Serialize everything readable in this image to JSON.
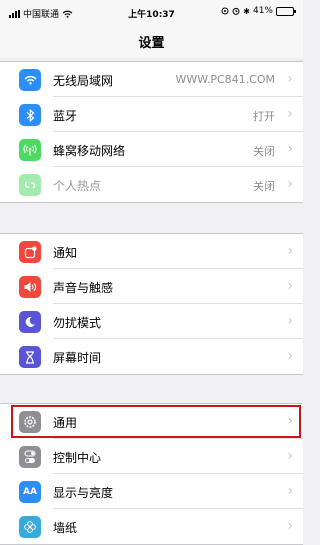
{
  "status_bar": {
    "carrier": "中国联通",
    "time": "上午10:37",
    "battery_percent": "41%",
    "battery_level": 0.41
  },
  "nav": {
    "title": "设置"
  },
  "colors": {
    "wifi": "#2e8ef7",
    "bluetooth": "#2e8ef7",
    "cellular": "#4cd964",
    "hotspot": "#4cd964",
    "notifications": "#f0473f",
    "sounds": "#f0473f",
    "dnd": "#5a54d6",
    "screen_time": "#5a54d6",
    "general": "#8e8e93",
    "control_center": "#8e8e93",
    "display": "#2e8ef7",
    "wallpaper": "#36aadc",
    "highlight": "#d0121e"
  },
  "group1": {
    "rows": [
      {
        "label": "无线局域网",
        "value": "WWW.PC841.COM",
        "icon": "wifi-icon"
      },
      {
        "label": "蓝牙",
        "value": "打开",
        "icon": "bluetooth-icon"
      },
      {
        "label": "蜂窝移动网络",
        "value": "关闭",
        "icon": "cellular-icon"
      },
      {
        "label": "个人热点",
        "value": "关闭",
        "icon": "hotspot-icon"
      }
    ]
  },
  "group2": {
    "rows": [
      {
        "label": "通知",
        "icon": "notifications-icon"
      },
      {
        "label": "声音与触感",
        "icon": "speaker-icon"
      },
      {
        "label": "勿扰模式",
        "icon": "moon-icon"
      },
      {
        "label": "屏幕时间",
        "icon": "hourglass-icon"
      }
    ]
  },
  "group3": {
    "rows": [
      {
        "label": "通用",
        "icon": "gear-icon"
      },
      {
        "label": "控制中心",
        "icon": "toggles-icon"
      },
      {
        "label": "显示与亮度",
        "icon": "text-size-icon",
        "icon_text": "AA"
      },
      {
        "label": "墙纸",
        "icon": "flower-icon"
      }
    ]
  }
}
